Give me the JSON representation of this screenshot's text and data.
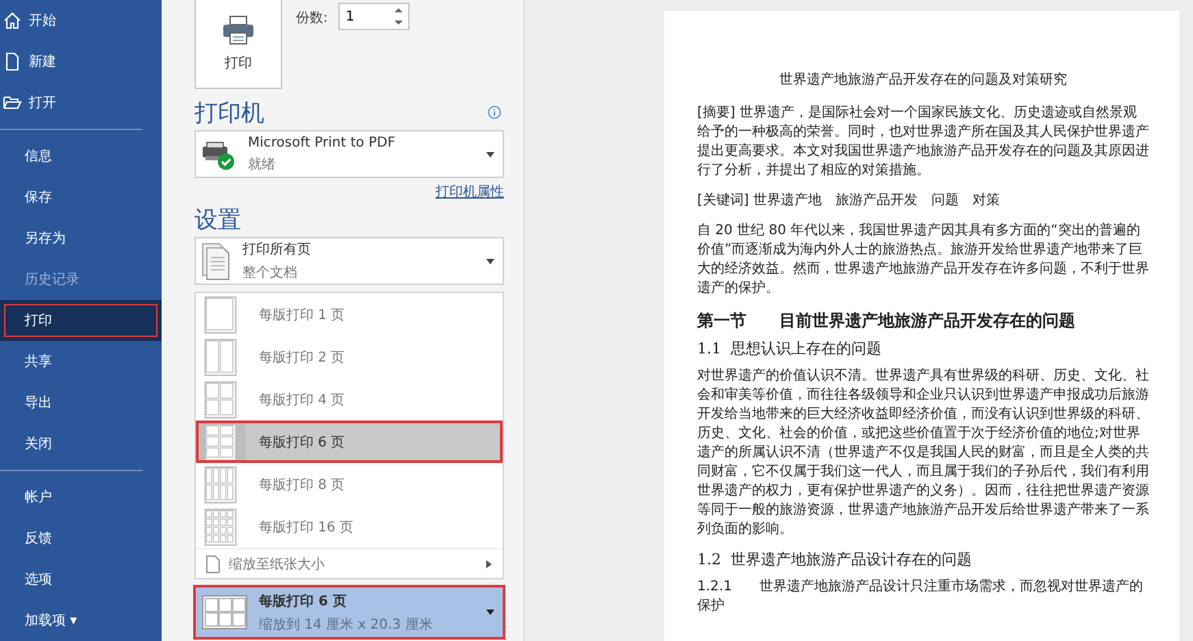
{
  "sidebar": {
    "top_items": [
      {
        "label": "开始",
        "selected": false
      },
      {
        "label": "新建",
        "selected": false
      },
      {
        "label": "打开",
        "selected": false
      }
    ],
    "items": [
      {
        "label": "信息",
        "selected": false,
        "disabled": false,
        "outlined": false
      },
      {
        "label": "保存",
        "selected": false,
        "disabled": false,
        "outlined": false
      },
      {
        "label": "另存为",
        "selected": false,
        "disabled": false,
        "outlined": false
      },
      {
        "label": "历史记录",
        "selected": false,
        "disabled": true,
        "outlined": false
      },
      {
        "label": "打印",
        "selected": true,
        "disabled": false,
        "outlined": true
      },
      {
        "label": "共享",
        "selected": false,
        "disabled": false,
        "outlined": false
      },
      {
        "label": "导出",
        "selected": false,
        "disabled": false,
        "outlined": false
      },
      {
        "label": "关闭",
        "selected": false,
        "disabled": false,
        "outlined": false
      }
    ],
    "bottom_items": [
      {
        "label": "帐户",
        "selected": false
      },
      {
        "label": "反馈",
        "selected": false
      },
      {
        "label": "选项",
        "selected": false
      },
      {
        "label": "加载项 ▾",
        "selected": false
      }
    ]
  },
  "print_panel": {
    "print_button": "打印",
    "copies_label": "份数:",
    "copies_value": "1",
    "printer_heading": "打印机",
    "printer": {
      "name": "Microsoft Print to PDF",
      "status": "就绪"
    },
    "printer_properties_link": "打印机属性",
    "settings_heading": "设置",
    "pages_dropdown": {
      "title": "打印所有页",
      "subtitle": "整个文档"
    },
    "pages_per_sheet_menu": {
      "options": [
        {
          "label": "每版打印 1 页",
          "selected": false,
          "outlined": false
        },
        {
          "label": "每版打印 2 页",
          "selected": false,
          "outlined": false
        },
        {
          "label": "每版打印 4 页",
          "selected": false,
          "outlined": false
        },
        {
          "label": "每版打印 6 页",
          "selected": true,
          "outlined": true
        },
        {
          "label": "每版打印 8 页",
          "selected": false,
          "outlined": false
        },
        {
          "label": "每版打印 16 页",
          "selected": false,
          "outlined": false
        }
      ],
      "scale_item": "缩放至纸张大小"
    },
    "pages_per_sheet_dropdown": {
      "title": "每版打印 6 页",
      "subtitle": "缩放到 14 厘米 x 20.3 厘米",
      "outlined": true
    }
  },
  "document": {
    "title": "世界遗产地旅游产品开发存在的问题及对策研究",
    "blocks": [
      {
        "kind": "paragraph",
        "text": "[摘要] 世界遗产，是国际社会对一个国家民族文化、历史遗迹或自然景观给予的一种极高的荣誉。同时，也对世界遗产所在国及其人民保护世界遗产提出更高要求。本文对我国世界遗产地旅游产品开发存在的问题及其原因进行了分析，并提出了相应的对策措施。"
      },
      {
        "kind": "paragraph",
        "text": "[关键词] 世界遗产地　旅游产品开发　问题　对策"
      },
      {
        "kind": "paragraph",
        "text": "自 20 世纪 80 年代以来，我国世界遗产因其具有多方面的“突出的普遍的价值”而逐渐成为海内外人士的旅游热点。旅游开发给世界遗产地带来了巨大的经济效益。然而，世界遗产地旅游产品开发存在许多问题，不利于世界遗产的保护。"
      },
      {
        "kind": "heading",
        "text": "第一节　　目前世界遗产地旅游产品开发存在的问题"
      },
      {
        "kind": "subheading",
        "text": "1.1  思想认识上存在的问题"
      },
      {
        "kind": "paragraph",
        "text": "对世界遗产的价值认识不清。世界遗产具有世界级的科研、历史、文化、社会和审美等价值，而往往各级领导和企业只认识到世界遗产申报成功后旅游开发给当地带来的巨大经济收益即经济价值，而没有认识到世界级的科研、历史、文化、社会的价值，或把这些价值置于次于经济价值的地位;对世界遗产的所属认识不清（世界遗产不仅是我国人民的财富，而且是全人类的共同财富，它不仅属于我们这一代人，而且属于我们的子孙后代，我们有利用世界遗产的权力，更有保护世界遗产的义务）。因而，往往把世界遗产资源等同于一般的旅游资源，世界遗产地旅游产品开发后给世界遗产带来了一系列负面的影响。"
      },
      {
        "kind": "subheading",
        "text": "1.2  世界遗产地旅游产品设计存在的问题"
      },
      {
        "kind": "subsubheading",
        "text": "1.2.1　　世界遗产地旅游产品设计只注重市场需求，而忽视对世界遗产的保护"
      }
    ]
  }
}
